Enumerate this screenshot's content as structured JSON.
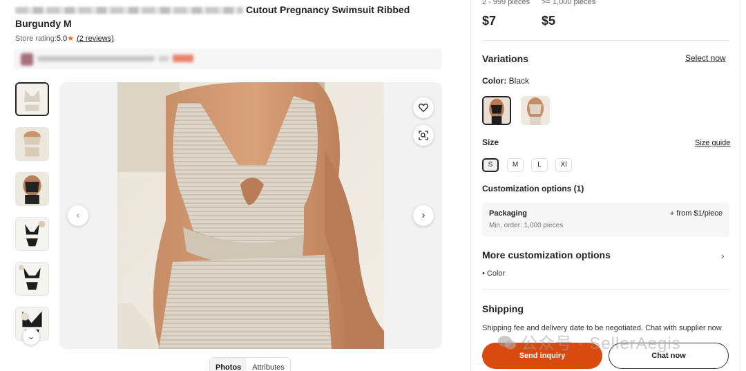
{
  "product": {
    "title_visible": "Cutout Pregnancy Swimsuit Ribbed",
    "title_line2": "Burgundy M",
    "store_rating_label": "Store rating:",
    "store_rating_value": "5.0",
    "reviews_link": "(2 reviews)"
  },
  "gallery": {
    "thumbnail_count": 6,
    "active_thumbnail": 1,
    "tabs": [
      "Photos",
      "Attributes"
    ],
    "active_tab": "Photos"
  },
  "pricing": {
    "tiers": [
      {
        "range": "2 - 999 pieces",
        "price": "$7"
      },
      {
        "range": ">= 1,000 pieces",
        "price": "$5"
      }
    ]
  },
  "variations": {
    "title": "Variations",
    "select_now": "Select now",
    "color_label": "Color:",
    "color_value": "Black",
    "color_swatches": [
      "black",
      "beige"
    ],
    "size_label": "Size",
    "size_guide": "Size guide",
    "sizes": [
      "S",
      "M",
      "L",
      "Xl"
    ],
    "selected_size": "S"
  },
  "customization": {
    "title": "Customization options (1)",
    "option_name": "Packaging",
    "option_price": "+ from $1/piece",
    "option_min_order": "Min. order: 1,000 pieces",
    "more_title": "More customization options",
    "more_items": [
      "Color"
    ]
  },
  "shipping": {
    "title": "Shipping",
    "text": "Shipping fee and delivery date to be negotiated. Chat with supplier now"
  },
  "actions": {
    "send_inquiry": "Send inquiry",
    "chat_now": "Chat now"
  },
  "watermark": {
    "text": "公众号 · SellerAegis"
  },
  "colors": {
    "accent": "#d94a10",
    "star": "#f16b1a",
    "panel_bg": "#f6f6f6"
  },
  "icons": {
    "favorite": "heart-icon",
    "image_search": "scan-icon",
    "prev": "chevron-left-icon",
    "next": "chevron-right-icon",
    "thumb_scroll": "chevron-down-icon",
    "more": "chevron-right-icon"
  }
}
